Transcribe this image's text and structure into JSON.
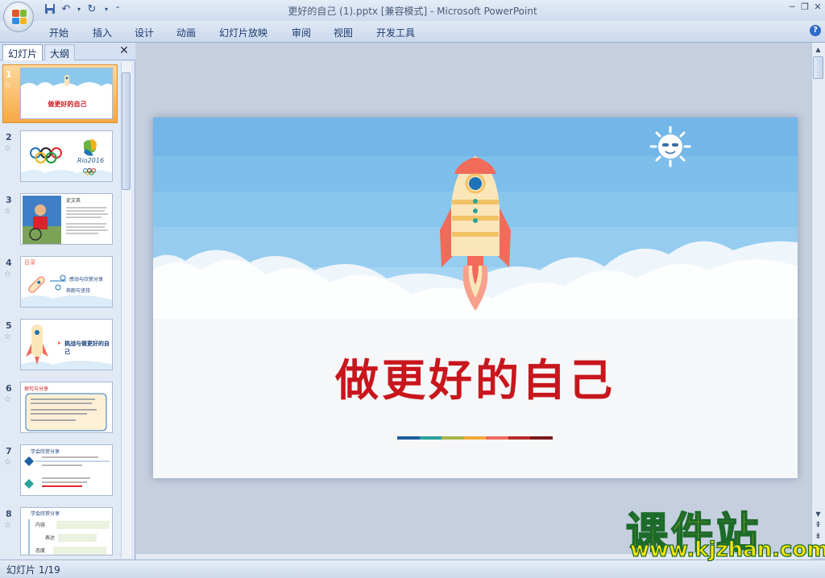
{
  "window": {
    "title": "更好的自己 (1).pptx [兼容模式] - Microsoft PowerPoint"
  },
  "quick_access": [
    "save-icon",
    "undo-icon",
    "redo-icon",
    "customize-icon"
  ],
  "ribbon": {
    "tabs": [
      "开始",
      "插入",
      "设计",
      "动画",
      "幻灯片放映",
      "审阅",
      "视图",
      "开发工具"
    ]
  },
  "panel": {
    "tab_slides": "幻灯片",
    "tab_outline": "大纲",
    "thumbnails": [
      {
        "num": "1",
        "title": "做更好的自己"
      },
      {
        "num": "2",
        "label": "Rio2016"
      },
      {
        "num": "3",
        "title": "史文英"
      },
      {
        "num": "4",
        "title": "目录",
        "line1": "感动与欣赏分享",
        "line2": "奔跑与坚持"
      },
      {
        "num": "5",
        "title": "挑战与做更好的自己"
      },
      {
        "num": "6",
        "title": "探究与分享"
      },
      {
        "num": "7",
        "title": "学会欣赏分享"
      },
      {
        "num": "8",
        "title": "学会欣赏分享",
        "line1": "内容",
        "line2": "表达",
        "line3": "态度"
      }
    ]
  },
  "slide": {
    "title": "做更好的自己",
    "colors": {
      "sky": "#8cc8ee",
      "title": "#c8161d",
      "rocket_body": "#fbe6b9",
      "rocket_fin": "#f16b5a",
      "porthole": "#1e73b9"
    },
    "divider_colors": [
      "#1f5f9e",
      "#2aa39b",
      "#a6b547",
      "#f3a93a",
      "#ef6b5d",
      "#b82a2a",
      "#7b1a1a"
    ]
  },
  "status": {
    "slide_indicator": "幻灯片 1/19"
  },
  "watermark": {
    "title": "课件站",
    "url": "www.kjzhan.com"
  }
}
